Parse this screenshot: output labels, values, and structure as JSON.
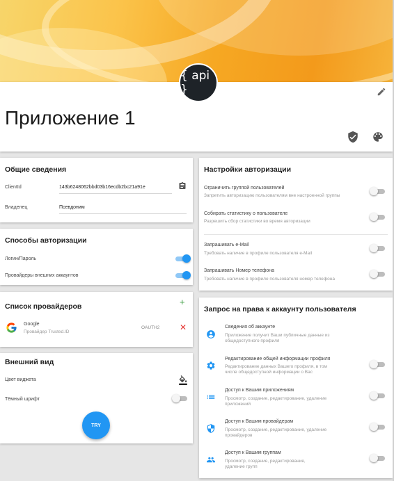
{
  "header": {
    "logo_text": "{ api }",
    "app_title": "Приложение 1",
    "icons": [
      "edit-icon",
      "shield-check-icon",
      "palette-icon"
    ]
  },
  "general": {
    "title": "Общие сведения",
    "client_id_label": "ClientId",
    "client_id_value": "143b6248062bbd03b16ecdb2bc21a91e",
    "owner_label": "Владелец",
    "owner_value": "Псевдоним"
  },
  "auth_methods": {
    "title": "Способы авторизации",
    "items": [
      {
        "label": "Логин/Пароль",
        "enabled": true
      },
      {
        "label": "Провайдеры внешних аккаунтов",
        "enabled": true
      }
    ]
  },
  "providers": {
    "title": "Список провайдеров",
    "items": [
      {
        "name": "Google",
        "subtitle": "Провайдер Trusted.ID",
        "type": "OAUTH2"
      }
    ]
  },
  "appearance": {
    "title": "Внешний вид",
    "widget_color_label": "Цвет виджета",
    "dark_font_label": "Тёмный шрифт",
    "try_label": "TRY"
  },
  "auth_settings": {
    "title": "Настройки авторизации",
    "items": [
      {
        "title": "Ограничить группой пользователей",
        "desc": "Запретить авторизацию пользователям вне настроенной группы"
      },
      {
        "title": "Собирать статистику о пользователе",
        "desc": "Разрешить сбор статистики во время авторизации"
      },
      {
        "title": "Запрашивать e-Mail",
        "desc": "Требовать наличие в профиле пользователя e-Mail"
      },
      {
        "title": "Запрашивать Номер телефона",
        "desc": "Требовать наличие в профиле пользователя номер телефона"
      }
    ]
  },
  "permissions": {
    "title": "Запрос на права к аккаунту пользователя",
    "items": [
      {
        "icon": "account-circle-icon",
        "title": "Сведения об аккаунте",
        "desc1": "Приложение получит Ваши публичные данные из",
        "desc2": "общедоступного профиля"
      },
      {
        "icon": "gear-icon",
        "title": "Редактирование общей информации профиля",
        "desc1": "Редактирование данных Вашего профиля, в том",
        "desc2": "числе общедоступной информации о Вас"
      },
      {
        "icon": "list-icon",
        "title": "Доступ к Вашим приложениям",
        "desc1": "Просмотр, создание, редактирование, удаление",
        "desc2": "приложений"
      },
      {
        "icon": "shield-icon",
        "title": "Доступ к Вашим провайдерам",
        "desc1": "Просмотр, создание, редактирование, удаление",
        "desc2": "провайдеров"
      },
      {
        "icon": "group-icon",
        "title": "Доступ к Вашим группам",
        "desc1": "Просмотр, создание, редактирование,",
        "desc2": "удаление групп"
      }
    ]
  },
  "colors": {
    "accent": "#2196f3",
    "banner": "#f6a823",
    "remove": "#e53935",
    "add": "#43a047"
  }
}
